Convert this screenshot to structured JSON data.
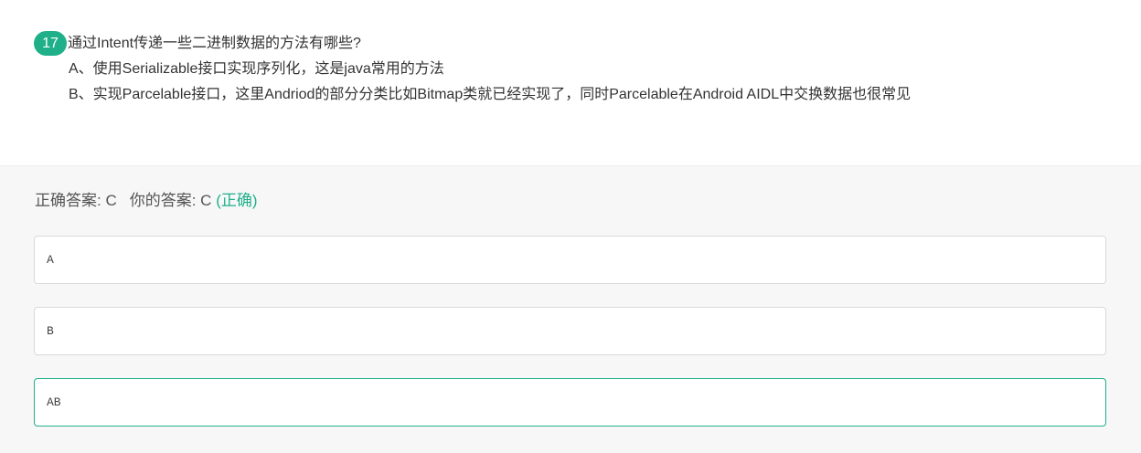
{
  "question": {
    "number": "17",
    "title": "通过Intent传递一些二进制数据的方法有哪些?",
    "lines": [
      "A、使用Serializable接口实现序列化，这是java常用的方法",
      "B、实现Parcelable接口，这里Andriod的部分分类比如Bitmap类就已经实现了，同时Parcelable在Android AIDL中交换数据也很常见"
    ]
  },
  "answer": {
    "correct_label": "正确答案: C",
    "yours_label": "你的答案: C",
    "status": "(正确)"
  },
  "options": [
    {
      "text": "A",
      "selected": false
    },
    {
      "text": "B",
      "selected": false
    },
    {
      "text": "AB",
      "selected": true
    }
  ],
  "colors": {
    "accent": "#1fb08a",
    "answer_bg": "#f7f7f7",
    "border": "#d9d9d9"
  }
}
